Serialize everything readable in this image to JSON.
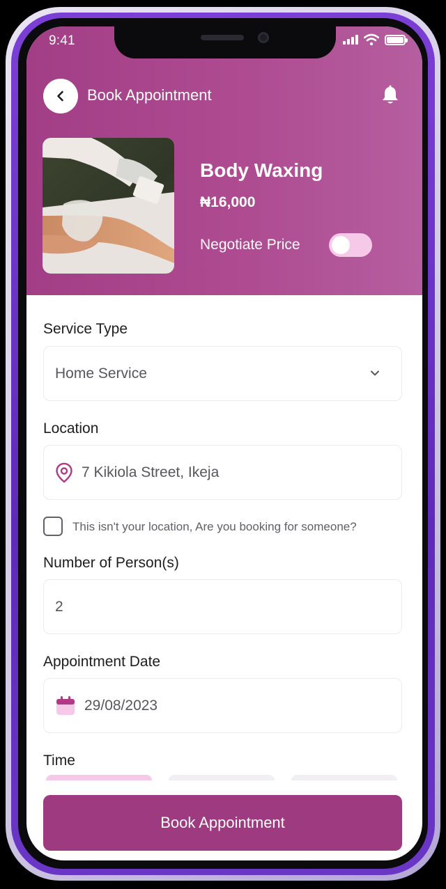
{
  "status_bar": {
    "time": "9:41"
  },
  "header": {
    "title": "Book Appointment"
  },
  "service": {
    "name": "Body Waxing",
    "price": "₦16,000",
    "negotiate_label": "Negotiate Price",
    "negotiate_enabled": false
  },
  "form": {
    "service_type": {
      "label": "Service Type",
      "value": "Home Service"
    },
    "location": {
      "label": "Location",
      "value": "7 Kikiola Street, Ikeja"
    },
    "booking_for_someone": {
      "label": "This isn't your location, Are you booking for someone?",
      "checked": false
    },
    "persons": {
      "label": "Number of Person(s)",
      "value": "2"
    },
    "date": {
      "label": "Appointment Date",
      "value": "29/08/2023"
    },
    "time": {
      "label": "Time"
    }
  },
  "cta": {
    "label": "Book Appointment"
  },
  "colors": {
    "brand": "#9d3a80",
    "hero": "#a84589",
    "toggle_track": "#f7c9e8",
    "icon_accent": "#b03a86"
  },
  "icons": {
    "back": "chevron-left-icon",
    "notification": "bell-icon",
    "dropdown": "chevron-down-icon",
    "location": "map-pin-icon",
    "date": "calendar-icon"
  }
}
